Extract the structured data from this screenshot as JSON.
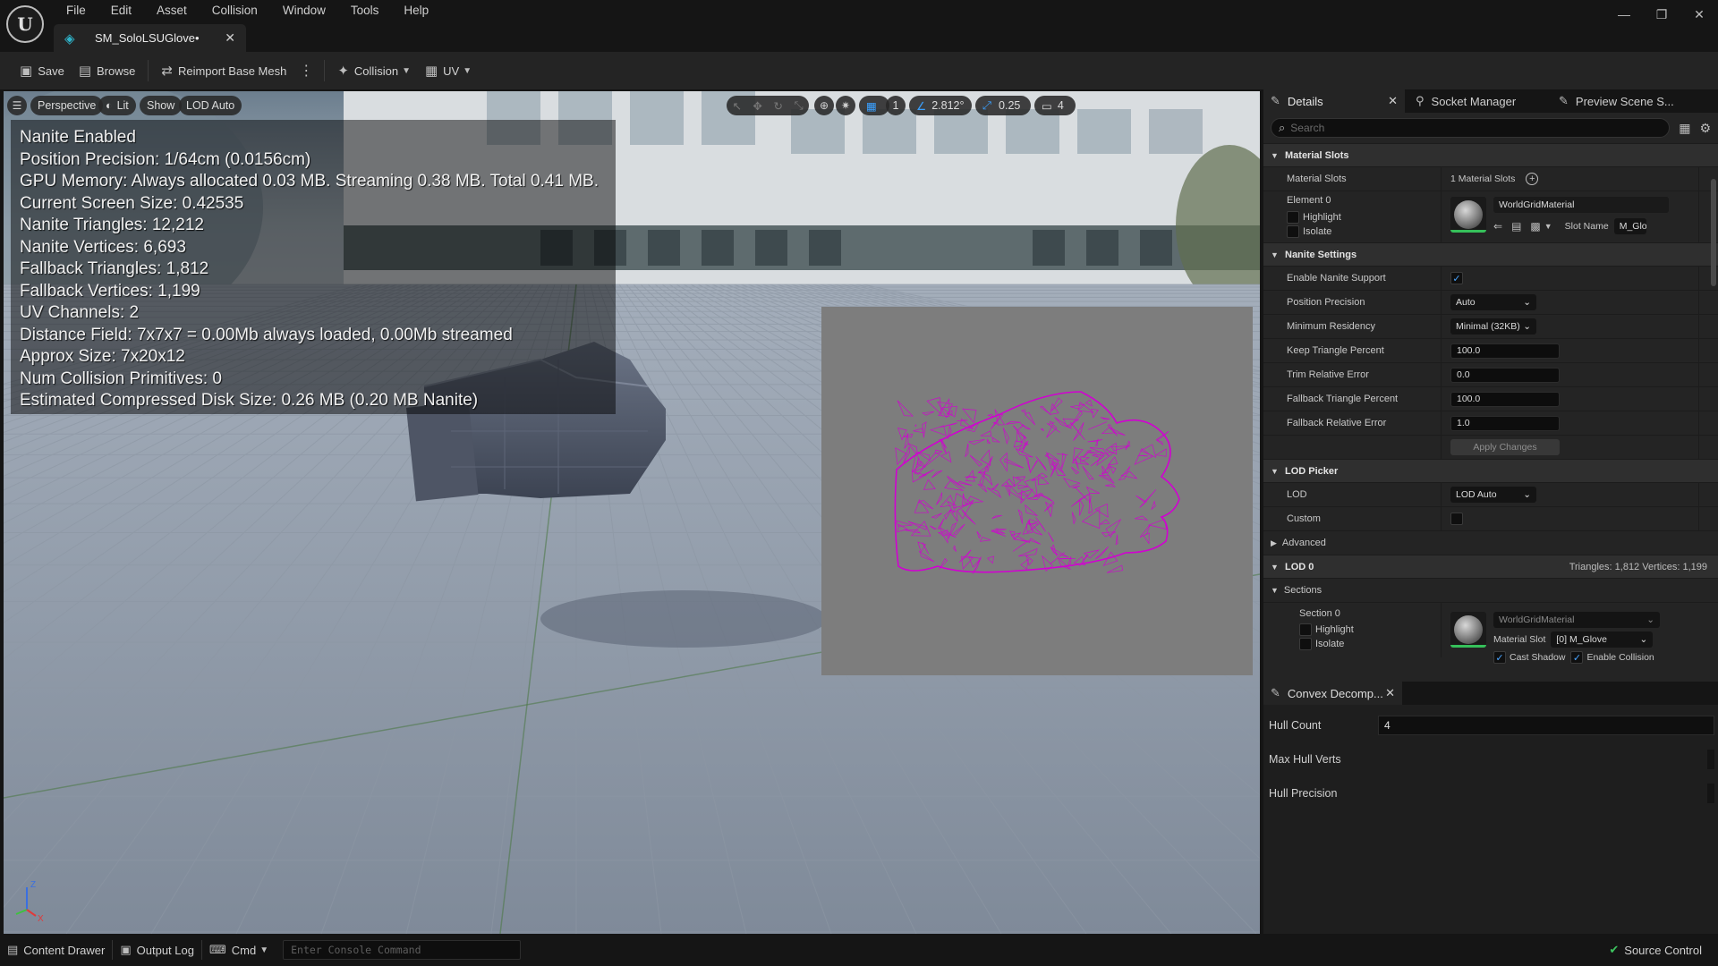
{
  "menu": [
    "File",
    "Edit",
    "Asset",
    "Collision",
    "Window",
    "Tools",
    "Help"
  ],
  "document_tab": {
    "title": "SM_SoloLSUGlove•"
  },
  "toolbar": {
    "save": "Save",
    "browse": "Browse",
    "reimport": "Reimport Base Mesh",
    "collision": "Collision",
    "uv": "UV"
  },
  "viewport": {
    "perspective": "Perspective",
    "lit": "Lit",
    "show": "Show",
    "lod": "LOD Auto",
    "grid_snap": "1",
    "rotation_snap": "2.812°",
    "scale_snap": "0.25",
    "camera_speed": "4",
    "stats": [
      "Nanite Enabled",
      "Position Precision: 1/64cm (0.0156cm)",
      "GPU Memory: Always allocated 0.03 MB. Streaming 0.38 MB. Total 0.41 MB.",
      "Current Screen Size:  0.42535",
      "Nanite Triangles:  12,212",
      "Nanite Vertices:  6,693",
      "Fallback Triangles:  1,812",
      "Fallback Vertices:  1,199",
      "UV Channels:  2",
      "Distance Field:  7x7x7 = 0.00Mb always loaded, 0.00Mb streamed",
      "Approx Size: 7x20x12",
      "Num Collision Primitives:  0",
      "Estimated Compressed Disk Size: 0.26 MB (0.20 MB Nanite)"
    ],
    "axis": {
      "z": "Z",
      "x": "X"
    }
  },
  "panel_tabs": [
    "Details",
    "Socket Manager",
    "Preview Scene S..."
  ],
  "search": {
    "placeholder": "Search"
  },
  "details": {
    "material_slots": {
      "header": "Material Slots",
      "label": "Material Slots",
      "count": "1 Material Slots",
      "element": "Element 0",
      "highlight": "Highlight",
      "isolate": "Isolate",
      "material": "WorldGridMaterial",
      "slot_name_label": "Slot Name",
      "slot_name": "M_Glo"
    },
    "nanite": {
      "header": "Nanite Settings",
      "enable_label": "Enable Nanite Support",
      "position_precision_label": "Position Precision",
      "position_precision": "Auto",
      "min_residency_label": "Minimum Residency",
      "min_residency": "Minimal (32KB)",
      "keep_tri_label": "Keep Triangle Percent",
      "keep_tri": "100.0",
      "trim_err_label": "Trim Relative Error",
      "trim_err": "0.0",
      "fallback_tri_label": "Fallback Triangle Percent",
      "fallback_tri": "100.0",
      "fallback_err_label": "Fallback Relative Error",
      "fallback_err": "1.0",
      "apply": "Apply Changes"
    },
    "lod_picker": {
      "header": "LOD Picker",
      "lod_label": "LOD",
      "lod_value": "LOD Auto",
      "custom_label": "Custom",
      "advanced": "Advanced"
    },
    "lod0": {
      "header": "LOD 0",
      "summary": "Triangles: 1,812    Vertices: 1,199",
      "sections": "Sections",
      "section0": "Section 0",
      "highlight": "Highlight",
      "isolate": "Isolate",
      "material": "WorldGridMaterial",
      "material_slot_label": "Material Slot",
      "material_slot": "[0] M_Glove",
      "cast_shadow": "Cast Shadow",
      "enable_collision": "Enable Collision"
    }
  },
  "convex": {
    "tab": "Convex Decomp...",
    "hull_count_label": "Hull Count",
    "hull_count": "4",
    "max_hull_verts_label": "Max Hull Verts",
    "hull_precision_label": "Hull Precision"
  },
  "statusbar": {
    "content_drawer": "Content Drawer",
    "output_log": "Output Log",
    "cmd": "Cmd",
    "console_placeholder": "Enter Console Command",
    "source_control": "Source Control"
  },
  "colors": {
    "accent": "#3aa0ff",
    "wireframe": "#d200d2",
    "ok": "#3dc45f"
  }
}
